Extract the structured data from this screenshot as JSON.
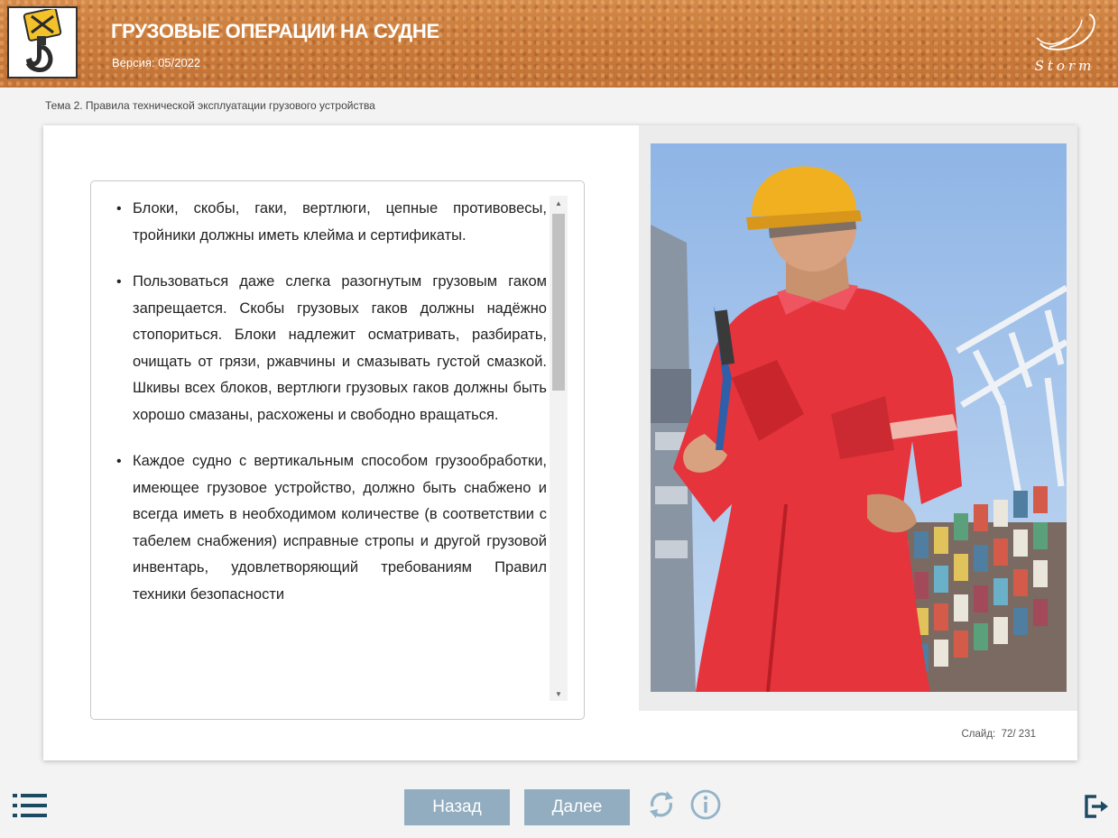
{
  "header": {
    "title": "ГРУЗОВЫЕ ОПЕРАЦИИ НА СУДНЕ",
    "version": "Версия: 05/2022",
    "brand": "Storm"
  },
  "breadcrumb": "Тема 2. Правила технической эксплуатации грузового устройства",
  "content": {
    "items": [
      "Блоки, скобы, гаки, вертлюги, цепные противовесы, тройники должны иметь клейма и сертификаты.",
      "Пользоваться даже слегка разогнутым грузовым гаком запрещается. Скобы грузовых гаков должны надёжно стопориться. Блоки надлежит осматривать, разбирать, очищать от грязи, ржавчины и смазывать густой смазкой. Шкивы всех блоков, вертлюги грузовых гаков должны быть хорошо смазаны, расхожены и свободно вращаться.",
      "Каждое судно с вертикальным способом грузообработки, имеющее грузовое устройство, должно быть снабжено и всегда иметь в необходимом количестве (в соответствии с табелем снабжения) исправные стропы и другой грузовой инвентарь, удовлетворяющий требованиям Правил техники безопасности"
    ]
  },
  "slide": {
    "label": "Слайд:",
    "current": "72",
    "total": "231",
    "counter": "72/ 231"
  },
  "footer": {
    "back_label": "Назад",
    "next_label": "Далее"
  },
  "icons": {
    "menu": "list-menu-icon",
    "reload": "reload-icon",
    "info": "info-icon",
    "exit": "exit-icon",
    "logo": "crane-hook-icon"
  },
  "colors": {
    "header": "#c97a3a",
    "nav_button": "#92adc0",
    "icon_dark": "#1d4a63",
    "icon_light": "#93b3c8"
  }
}
